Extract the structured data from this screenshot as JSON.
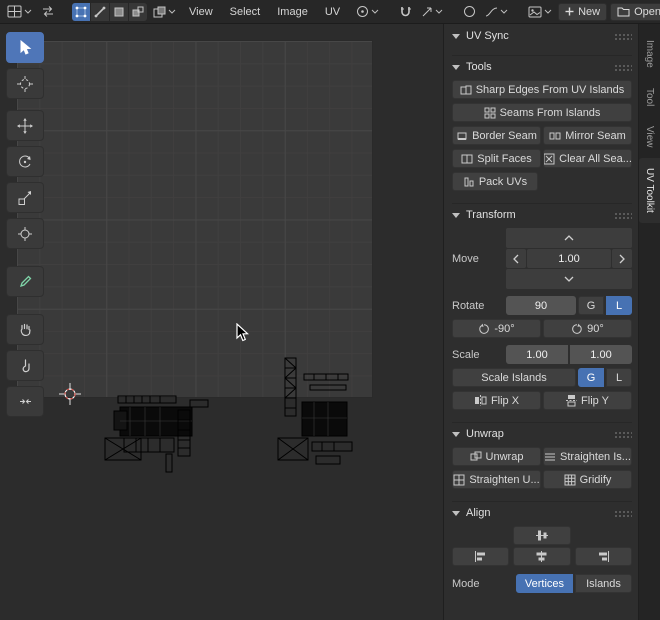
{
  "topbar": {
    "menus": [
      "View",
      "Select",
      "Image",
      "UV"
    ],
    "new_label": "New",
    "open_label": "Open"
  },
  "sidebar_tabs": [
    "Image",
    "Tool",
    "View",
    "UV Toolkit"
  ],
  "panel": {
    "uv_sync_header": "UV Sync",
    "tools_header": "Tools",
    "transform_header": "Transform",
    "unwrap_header": "Unwrap",
    "align_header": "Align",
    "tools": {
      "sharp_edges": "Sharp Edges From UV Islands",
      "seams_from_islands": "Seams From Islands",
      "border_seam": "Border Seam",
      "mirror_seam": "Mirror Seam",
      "split_faces": "Split Faces",
      "clear_all_seams": "Clear All Sea...",
      "pack_uvs": "Pack UVs"
    },
    "transform": {
      "move_label": "Move",
      "move_value": "1.00",
      "rotate_label": "Rotate",
      "rotate_value": "90",
      "global_label": "G",
      "local_label": "L",
      "rotate_ccw": "-90°",
      "rotate_cw": "90°",
      "scale_label": "Scale",
      "scale_x": "1.00",
      "scale_y": "1.00",
      "scale_islands": "Scale Islands",
      "flip_x": "Flip X",
      "flip_y": "Flip Y"
    },
    "unwrap": {
      "unwrap": "Unwrap",
      "straighten_islands": "Straighten Is...",
      "straighten_uvs": "Straighten U...",
      "gridify": "Gridify"
    },
    "align": {
      "mode_label": "Mode",
      "vertices": "Vertices",
      "islands": "Islands"
    }
  },
  "colors": {
    "accent": "#4772b3"
  }
}
